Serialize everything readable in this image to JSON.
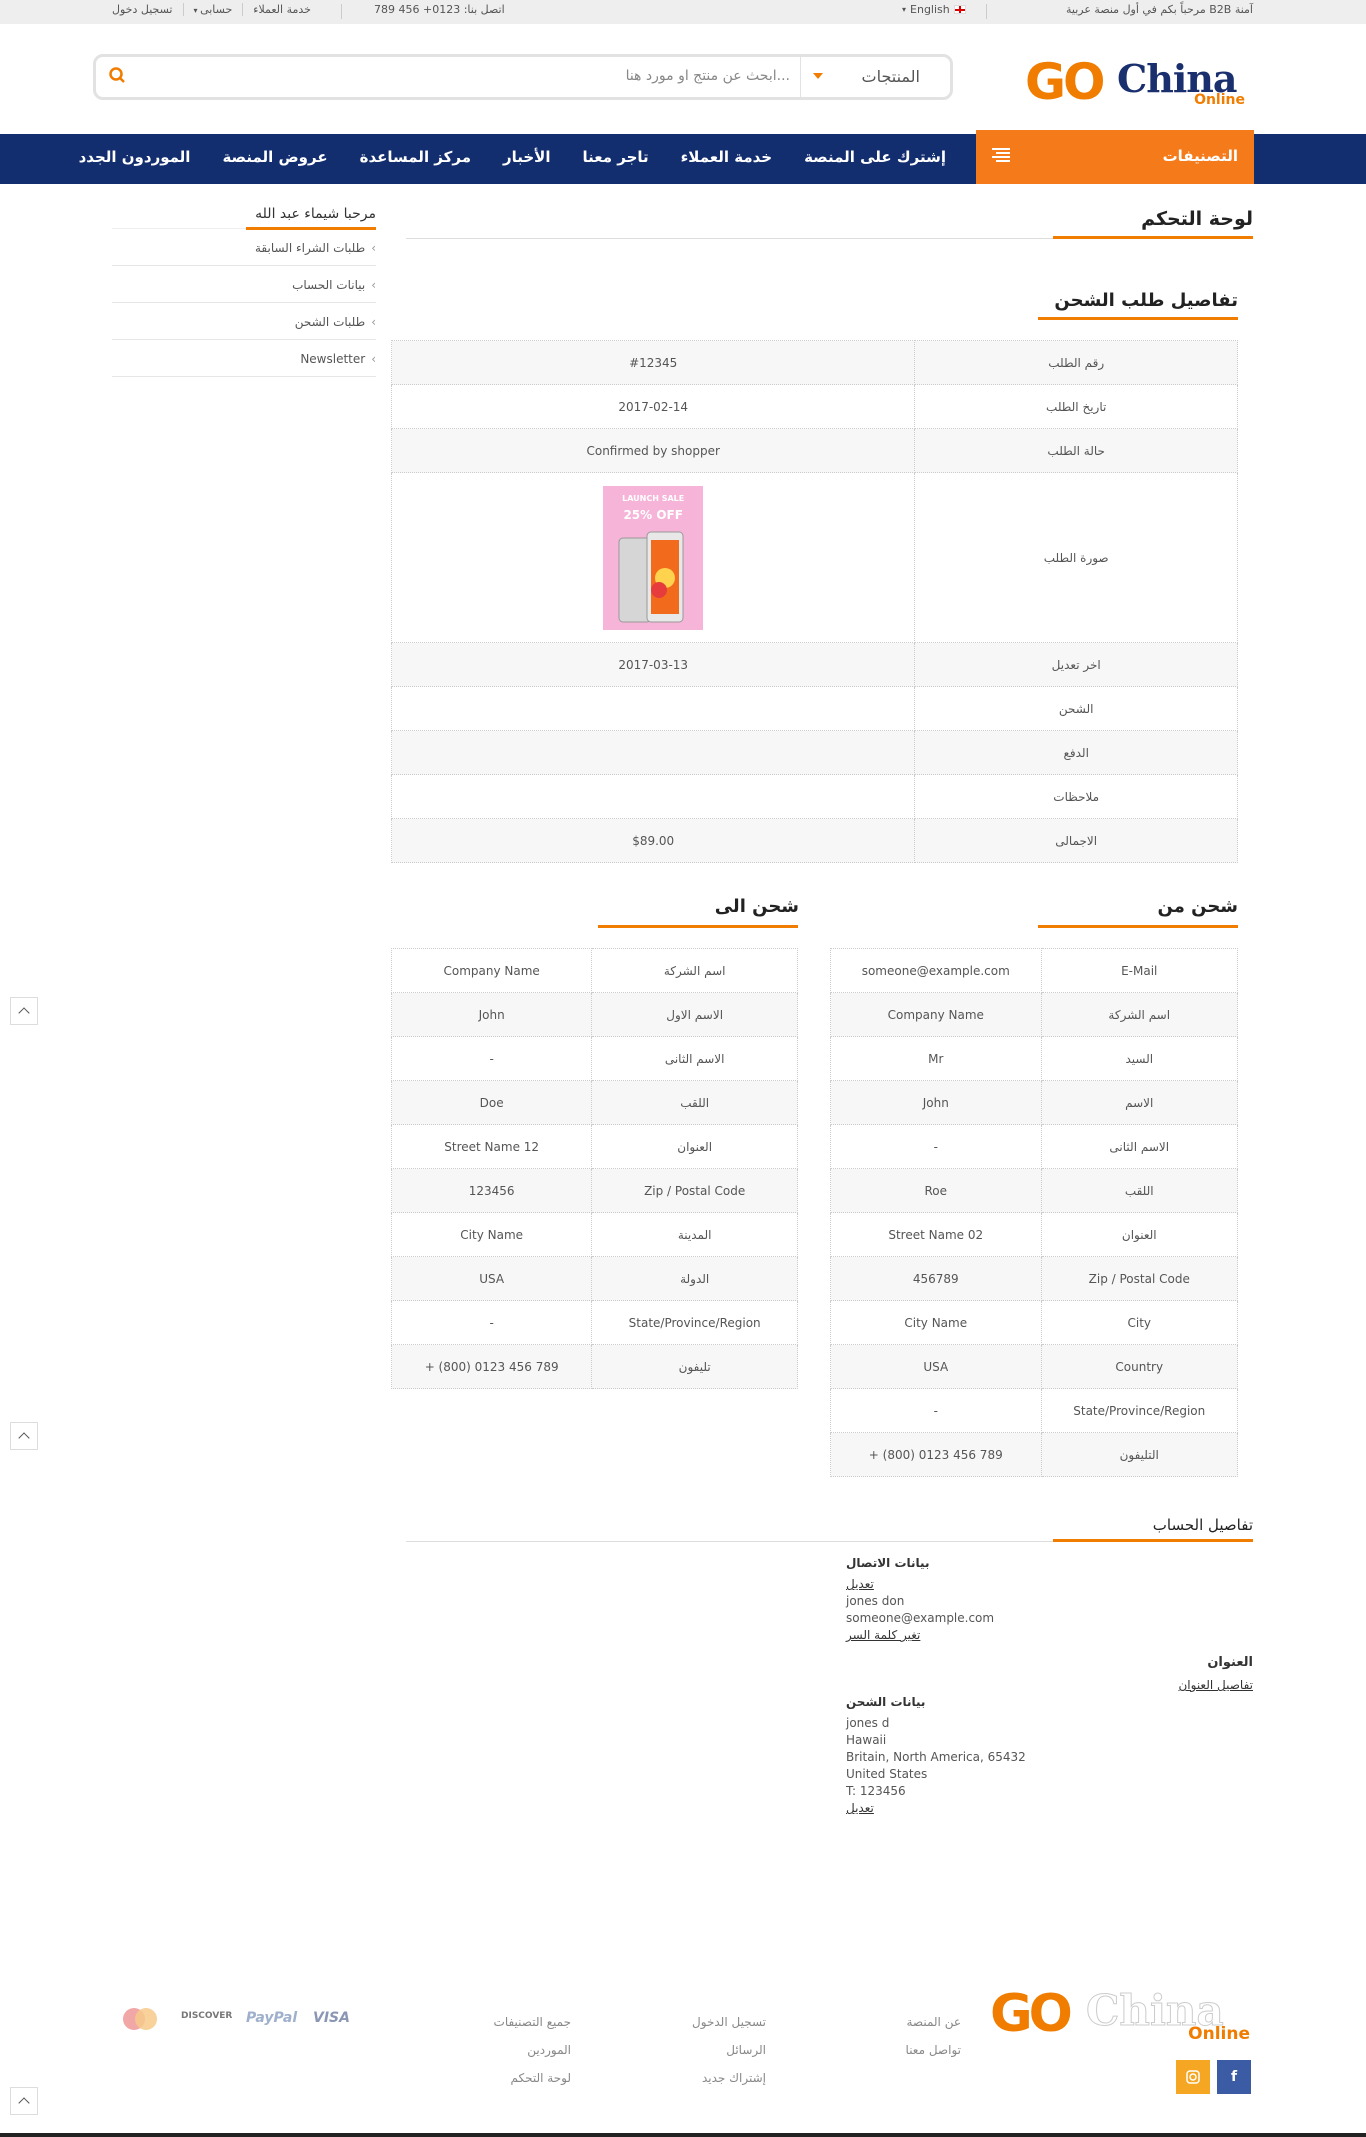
{
  "topbar": {
    "welcome": "مرحباً بكم في أول منصة عربية B2B آمنة",
    "language": "English",
    "phone": "اتصل بنا: 0123+ 456 789",
    "links": [
      "تسجيل دخول",
      "حسابى",
      "خدمة العملاء"
    ]
  },
  "header": {
    "logo_go": "GO",
    "logo_china": "China",
    "logo_online": "Online",
    "search_placeholder": "ابحث عن منتج او مورد هنا...",
    "search_category": "المنتجات"
  },
  "nav": {
    "categories_label": "التصنيفات",
    "items": [
      "إشترك على المنصة",
      "خدمة العملاء",
      "تاجر معنا",
      "الأخبار",
      "مركز المساعدة",
      "عروض المنصة",
      "الموردون الجدد"
    ]
  },
  "sidebar": {
    "greeting": "مرحبا شيماء عبد الله",
    "items": [
      "طلبات الشراء السابقة",
      "بيانات الحساب",
      "طلبات الشحن",
      "Newsletter"
    ]
  },
  "dashboard": {
    "title": "لوحة التحكم",
    "order_title": "تفاصيل طلب الشحن",
    "order_rows": [
      {
        "label": "رقم الطلب",
        "value": "#12345"
      },
      {
        "label": "تاريخ الطلب",
        "value": "2017-02-14"
      },
      {
        "label": "حالة الطلب",
        "value": "Confirmed by shopper"
      },
      {
        "label": "صورة الطلب",
        "value": ""
      },
      {
        "label": "اخر تعديل",
        "value": "2017-03-13"
      },
      {
        "label": "الشحن",
        "value": ""
      },
      {
        "label": "الدفع",
        "value": ""
      },
      {
        "label": "ملاحظات",
        "value": ""
      },
      {
        "label": "الاجمالى",
        "value": "$89.00"
      }
    ],
    "promo_line1": "LAUNCH SALE",
    "promo_line2": "25% OFF"
  },
  "ship_from": {
    "title": "شحن من",
    "rows": [
      {
        "label": "E-Mail",
        "value": "someone@example.com"
      },
      {
        "label": "اسم الشركة",
        "value": "Company Name"
      },
      {
        "label": "السيد",
        "value": "Mr"
      },
      {
        "label": "الاسم",
        "value": "John"
      },
      {
        "label": "الاسم الثانى",
        "value": "-"
      },
      {
        "label": "اللقب",
        "value": "Roe"
      },
      {
        "label": "العنوان",
        "value": "Street Name 02"
      },
      {
        "label": "Zip / Postal Code",
        "value": "456789"
      },
      {
        "label": "City",
        "value": "City Name"
      },
      {
        "label": "Country",
        "value": "USA"
      },
      {
        "label": "State/Province/Region",
        "value": "-"
      },
      {
        "label": "التليفون",
        "value": "+ (800) 0123 456 789"
      }
    ]
  },
  "ship_to": {
    "title": "شحن الى",
    "rows": [
      {
        "label": "اسم الشركة",
        "value": "Company Name"
      },
      {
        "label": "الاسم الاول",
        "value": "John"
      },
      {
        "label": "الاسم الثانى",
        "value": "-"
      },
      {
        "label": "اللقب",
        "value": "Doe"
      },
      {
        "label": "العنوان",
        "value": "Street Name 12"
      },
      {
        "label": "Zip / Postal Code",
        "value": "123456"
      },
      {
        "label": "المدينة",
        "value": "City Name"
      },
      {
        "label": "الدولة",
        "value": "USA"
      },
      {
        "label": "State/Province/Region",
        "value": "-"
      },
      {
        "label": "تليفون",
        "value": "+ (800) 0123 456 789"
      }
    ]
  },
  "account": {
    "title": "تفاصيل الحساب",
    "contact_heading": "بيانات الاتصال",
    "contact_edit": "تعديل",
    "contact_name": "jones don",
    "contact_email": "someone@example.com",
    "change_password": "تغير كلمة السر",
    "address_heading": "العنوان",
    "address_details": "تفاصيل العنوان",
    "shipping_heading": "بيانات الشحن",
    "shipping_lines": [
      "jones d",
      "Hawaii",
      "Britain, North America, 65432",
      "United States",
      "T: 123456"
    ],
    "shipping_edit": "تعديل"
  },
  "footer": {
    "col1": [
      "عن المنصة",
      "تواصل معنا"
    ],
    "col2": [
      "تسجيل الدخول",
      "الرسائل",
      "إشتراك جديد"
    ],
    "col3": [
      "جميع التصنيفات",
      "الموردين",
      "لوحة التحكم"
    ],
    "payments": [
      "VISA",
      "PayPal",
      "DISCOVER",
      "MasterCard"
    ],
    "social": [
      "facebook-icon",
      "instagram-icon"
    ],
    "colors": {
      "primary": "#132e6f",
      "accent": "#f47a1a"
    }
  }
}
